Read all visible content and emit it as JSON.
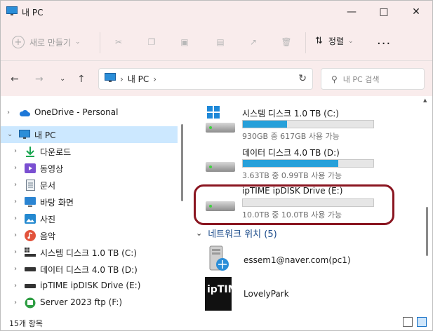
{
  "window": {
    "title": "내 PC"
  },
  "commandbar": {
    "new_label": "새로 만들기",
    "sort_label": "정렬",
    "more_label": "..."
  },
  "address": {
    "location": "내 PC",
    "search_placeholder": "내 PC 검색"
  },
  "tree": [
    {
      "label": "OneDrive - Personal",
      "icon": "cloud-icon",
      "color": "#1e78d8"
    },
    {
      "label": "내 PC",
      "icon": "computer-icon",
      "color": "#2b8ed8",
      "selected": true
    },
    {
      "label": "다운로드",
      "icon": "download-icon",
      "color": "#17a54f"
    },
    {
      "label": "동영상",
      "icon": "video-icon",
      "color": "#7a4fd1"
    },
    {
      "label": "문서",
      "icon": "document-icon",
      "color": "#6b7a8a"
    },
    {
      "label": "바탕 화면",
      "icon": "desktop-icon",
      "color": "#2a84d2"
    },
    {
      "label": "사진",
      "icon": "pictures-icon",
      "color": "#2489d0"
    },
    {
      "label": "음악",
      "icon": "music-icon",
      "color": "#e2533c"
    },
    {
      "label": "시스템 디스크 1.0 TB (C:)",
      "icon": "system-drive-icon",
      "color": "#333333"
    },
    {
      "label": "데이터 디스크 4.0 TB (D:)",
      "icon": "drive-icon",
      "color": "#333333"
    },
    {
      "label": "ipTIME ipDISK Drive (E:)",
      "icon": "drive-icon",
      "color": "#333333"
    },
    {
      "label": "Server 2023 ftp (F:)",
      "icon": "network-drive-icon",
      "color": "#2f9e44"
    }
  ],
  "drives": [
    {
      "name": "시스템 디스크 1.0 TB (C:)",
      "capacity": "930GB 중 617GB 사용 가능",
      "used_fraction": 0.34,
      "system": true
    },
    {
      "name": "데이터 디스크 4.0 TB (D:)",
      "capacity": "3.63TB 중 0.99TB 사용 가능",
      "used_fraction": 0.73,
      "system": false
    },
    {
      "name": "ipTIME ipDISK Drive (E:)",
      "capacity": "10.0TB 중 10.0TB 사용 가능",
      "used_fraction": 0.0,
      "system": false
    }
  ],
  "network_group": {
    "label": "네트워크 위치 (5)"
  },
  "network_items": [
    {
      "label": "essem1@naver.com(pc1)",
      "icon": "network-share-icon"
    },
    {
      "label": "LovelyPark",
      "icon": "iptime-logo-icon",
      "logo_text": "ipTIME"
    }
  ],
  "status": {
    "count": "15개 항목"
  }
}
